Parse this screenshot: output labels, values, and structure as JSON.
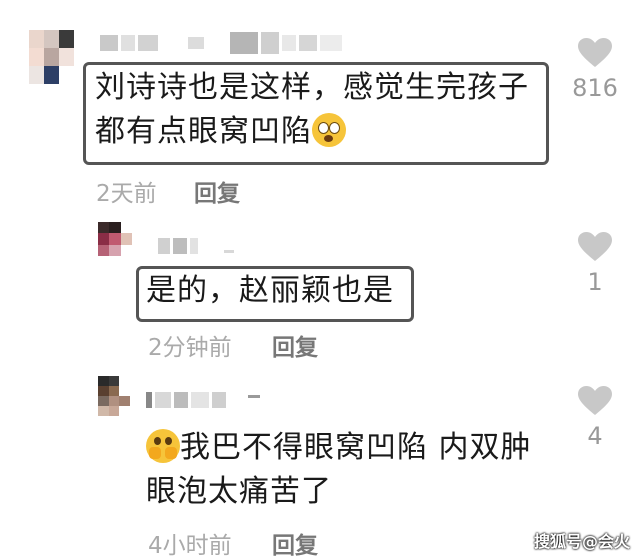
{
  "comments": [
    {
      "text_line1": "刘诗诗也是这样，感觉生完孩子",
      "text_line2": "都有点眼窝凹陷",
      "emoji": "flushed-face-emoji",
      "time": "2天前",
      "reply_label": "回复",
      "likes": "816"
    },
    {
      "text_line1": "是的，赵丽颖也是",
      "time": "2分钟前",
      "reply_label": "回复",
      "likes": "1"
    },
    {
      "emoji": "pleading-face-emoji",
      "text_line1": "我巴不得眼窝凹陷 内双肿",
      "text_line2": "眼泡太痛苦了",
      "time": "4小时前",
      "reply_label": "回复",
      "likes": "4"
    }
  ],
  "watermark": "搜狐号@会火",
  "colors": {
    "like_icon": "#c8c8c8",
    "box_border": "#555555",
    "meta_text": "#aaaaaa"
  }
}
